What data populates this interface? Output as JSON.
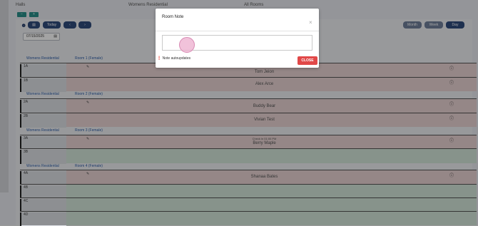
{
  "top": {
    "col1": "Halls",
    "col2": "Womens Residential",
    "col3": "All Rooms"
  },
  "toolbar": {
    "minus_label": "−",
    "plus_label": "+",
    "calendar_icon": "calendar-icon",
    "today_label": "Today",
    "prev_label": "‹",
    "next_label": "›",
    "month_label": "Month",
    "week_label": "Week",
    "day_label": "Day",
    "date_value": "07/15/2025"
  },
  "building": "Womens Residential",
  "rooms": [
    {
      "name": "Room 1 (Female)"
    },
    {
      "name": "Room 2 (Female)"
    },
    {
      "name": "Room 3 (Female)"
    },
    {
      "name": "Room 4 (Female)"
    }
  ],
  "beds": [
    {
      "bed": "1A",
      "guest": "Tom Jeion"
    },
    {
      "bed": "1B",
      "guest": "Alex Arce"
    },
    {
      "bed": "2A",
      "guest": "Buddy Bear"
    },
    {
      "bed": "2B",
      "guest": "Vivian Test"
    },
    {
      "bed": "3A",
      "guest": "Berry Maple",
      "checkin": "Check in 01:00 PM"
    },
    {
      "bed": "3B",
      "guest": ""
    },
    {
      "bed": "4A",
      "guest": "Shanaa Bates"
    },
    {
      "bed": "4B",
      "guest": ""
    },
    {
      "bed": "4C",
      "guest": ""
    },
    {
      "bed": "4D",
      "guest": ""
    }
  ],
  "modal": {
    "title": "Room Note",
    "close_icon": "×",
    "textarea_value": "",
    "note_text": "Note autoupdates",
    "close_button": "CLOSE"
  },
  "colors": {
    "primary": "#2f4b7c",
    "danger": "#e14848",
    "occupied": "#e9d4d4",
    "vacant": "#d3e6da"
  }
}
